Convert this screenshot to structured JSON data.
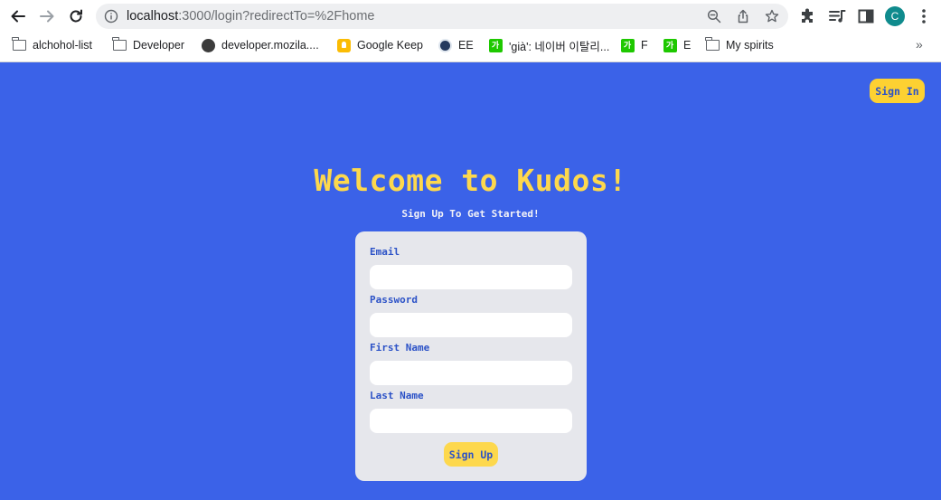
{
  "browser": {
    "url_host": "localhost",
    "url_path": ":3000/login?redirectTo=%2Fhome",
    "profile_initial": "C",
    "bookmarks": [
      {
        "label": "alchohol-list",
        "icon": "folder-icon"
      },
      {
        "label": "Developer",
        "icon": "folder-icon"
      },
      {
        "label": "developer.mozila....",
        "icon": "globe-icon"
      },
      {
        "label": "Google Keep",
        "icon": "google-keep-icon"
      },
      {
        "label": "EE",
        "icon": "ee-icon"
      },
      {
        "label": "'già': 네이버 이탈리...",
        "icon": "naver-dictionary-icon"
      },
      {
        "label": "F",
        "icon": "naver-dictionary-icon"
      },
      {
        "label": "E",
        "icon": "naver-dictionary-icon"
      },
      {
        "label": "My spirits",
        "icon": "folder-icon"
      }
    ],
    "naver_glyph": "가",
    "overflow_glyph": "»"
  },
  "page": {
    "signin_label": "Sign In",
    "title": "Welcome to Kudos!",
    "subtitle": "Sign Up To Get Started!",
    "form": {
      "email_label": "Email",
      "email_value": "",
      "password_label": "Password",
      "password_value": "",
      "first_name_label": "First Name",
      "first_name_value": "",
      "last_name_label": "Last Name",
      "last_name_value": "",
      "submit_label": "Sign Up"
    }
  },
  "colors": {
    "background": "#3b62e8",
    "accent_yellow": "#fdd84d",
    "button_text": "#2c52c7",
    "card": "#e6e7ec"
  }
}
